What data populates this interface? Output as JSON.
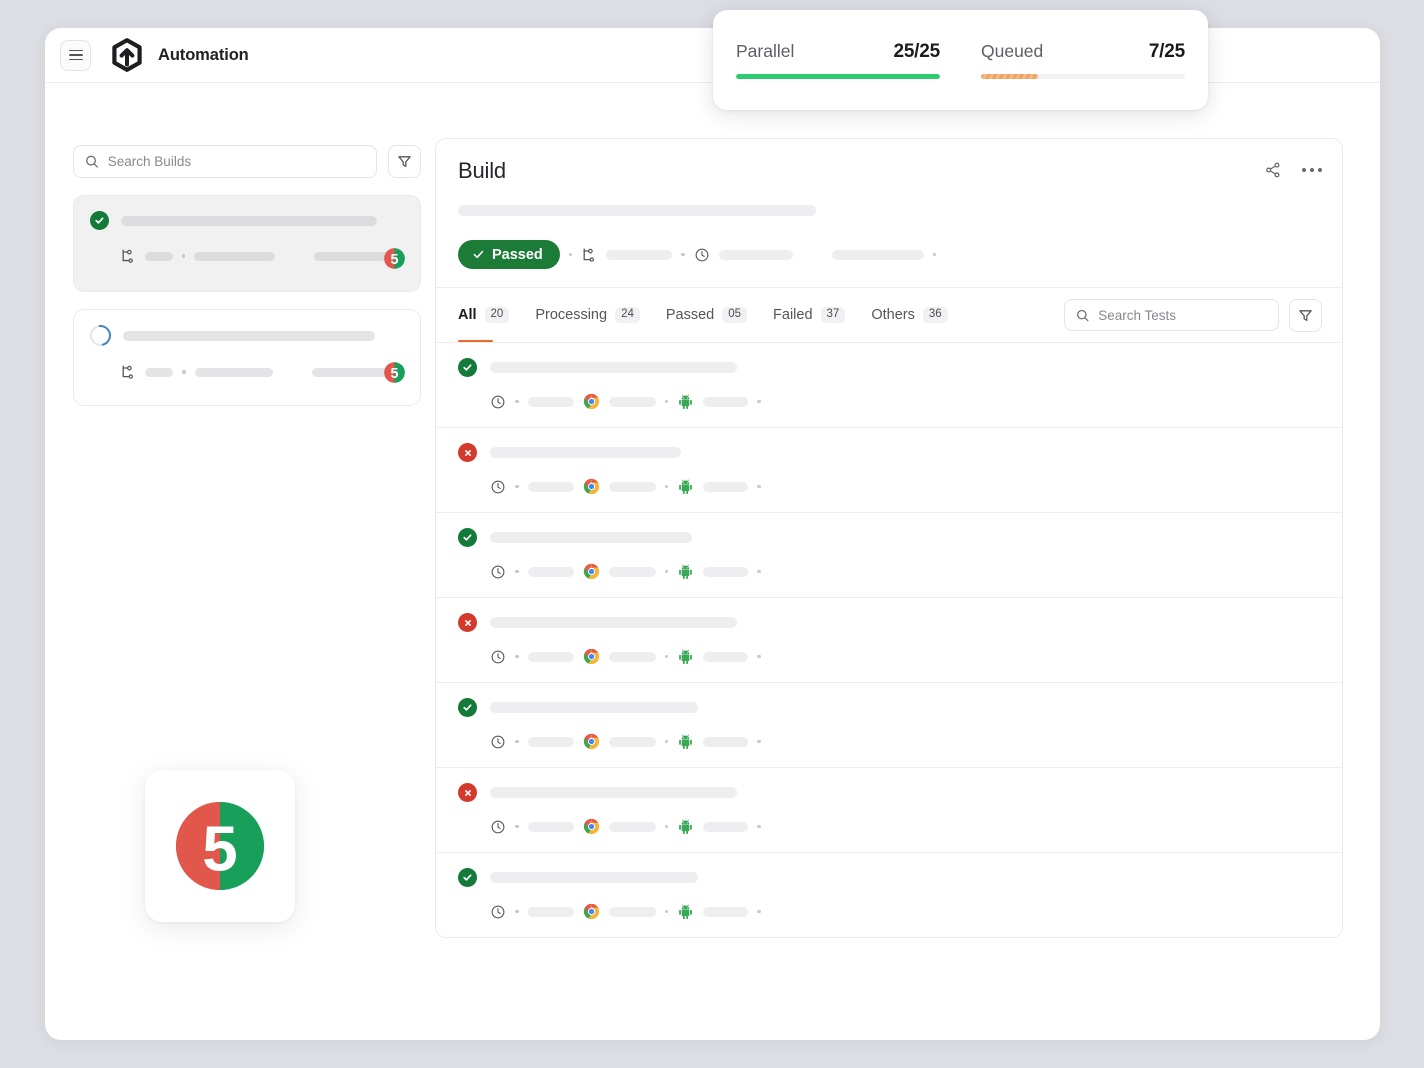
{
  "topbar": {
    "menu_label": "menu",
    "brand_title": "Automation"
  },
  "stats": {
    "items": [
      {
        "label": "Parallel",
        "value": "25/25",
        "percent": 100,
        "color": "#2ecc71",
        "style": "solid"
      },
      {
        "label": "Queued",
        "value": "7/25",
        "percent": 28,
        "color": "#f0a25c",
        "style": "striped"
      }
    ]
  },
  "sidebar": {
    "search": {
      "placeholder": "Search Builds",
      "value": ""
    },
    "filter_label": "Filter",
    "builds": [
      {
        "status": "passed",
        "selected": true,
        "badge": "5",
        "title_width": 256,
        "meta_widths": [
          28,
          82,
          78
        ]
      },
      {
        "status": "running",
        "selected": false,
        "badge": "5",
        "title_width": 252,
        "meta_widths": [
          28,
          78,
          76
        ]
      }
    ]
  },
  "detail": {
    "title": "Build",
    "share_label": "Share",
    "more_label": "More options",
    "subtitle_width": 358,
    "status_pill": "Passed",
    "meta_widths": [
      66,
      74,
      92
    ],
    "tabs": [
      {
        "label": "All",
        "count": "20",
        "active": true
      },
      {
        "label": "Processing",
        "count": "24",
        "active": false
      },
      {
        "label": "Passed",
        "count": "05",
        "active": false
      },
      {
        "label": "Failed",
        "count": "37",
        "active": false
      },
      {
        "label": "Others",
        "count": "36",
        "active": false
      }
    ],
    "tests_search": {
      "placeholder": "Search Tests",
      "value": ""
    },
    "tests_filter_label": "Filter",
    "tests": [
      {
        "status": "passed",
        "title_width": 247,
        "browser": "chrome",
        "platform": "android",
        "meta_widths": [
          46,
          47,
          45
        ]
      },
      {
        "status": "failed",
        "title_width": 191,
        "browser": "chrome",
        "platform": "android",
        "meta_widths": [
          46,
          47,
          45
        ]
      },
      {
        "status": "passed",
        "title_width": 202,
        "browser": "chrome",
        "platform": "android",
        "meta_widths": [
          46,
          47,
          45
        ]
      },
      {
        "status": "failed",
        "title_width": 247,
        "browser": "chrome",
        "platform": "android",
        "meta_widths": [
          46,
          47,
          45
        ]
      },
      {
        "status": "passed",
        "title_width": 208,
        "browser": "chrome",
        "platform": "android",
        "meta_widths": [
          46,
          47,
          45
        ]
      },
      {
        "status": "failed",
        "title_width": 247,
        "browser": "chrome",
        "platform": "android",
        "meta_widths": [
          46,
          47,
          45
        ]
      },
      {
        "status": "passed",
        "title_width": 208,
        "browser": "chrome",
        "platform": "android",
        "meta_widths": [
          46,
          47,
          45
        ]
      }
    ]
  },
  "logo_tile": {
    "badge_number": "5",
    "left_color": "#e2574c",
    "right_color": "#18a05a"
  },
  "theme": {
    "page_background": "#dddde4",
    "accent_orange": "#ea6a2b",
    "pass_green": "#137a39",
    "fail_red": "#d33a2c"
  }
}
